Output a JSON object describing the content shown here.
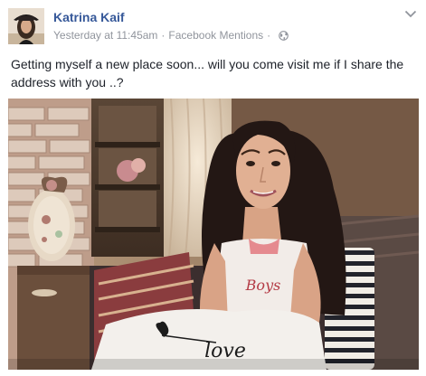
{
  "post": {
    "author": "Katrina Kaif",
    "timestamp": "Yesterday at 11:45am",
    "separator": "·",
    "source": "Facebook Mentions",
    "privacy_icon": "globe-icon",
    "menu_icon": "chevron-down-icon",
    "text": "Getting myself a new place soon... will you come visit me if I share the address with you ..?",
    "photo": {
      "pillow_text": "love",
      "shirt_text": "Boys"
    }
  },
  "colors": {
    "author_link": "#365899",
    "meta_gray": "#90949c",
    "body_text": "#1d2129"
  }
}
